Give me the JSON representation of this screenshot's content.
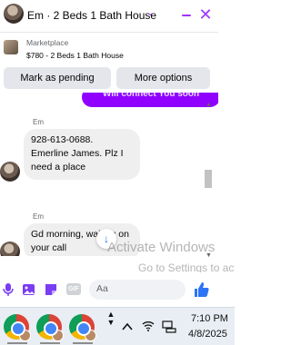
{
  "header": {
    "title": "Em · 2 Beds 1 Bath House",
    "chevron_glyph": "⌄",
    "close_glyph": "✕"
  },
  "marketplace": {
    "label": "Marketplace",
    "listing": "$780 - 2 Beds 1 Bath House",
    "mark_pending_label": "Mark as pending",
    "more_options_label": "More options"
  },
  "messages": {
    "previous_bubble_text": "Will connect You soon",
    "items": [
      {
        "sender": "Em",
        "text": "928-613-0688. Emerline James. Plz I need a place"
      },
      {
        "sender": "Em",
        "text": "Gd morning, waiting on your call"
      }
    ]
  },
  "overlay": {
    "line1": "Activate Windows",
    "line2": "Go to Settings to activate Windows."
  },
  "composer": {
    "placeholder": "Aa",
    "gif_label": "GIF"
  },
  "taskbar": {
    "time": "7:10 PM",
    "date": "4/8/2025"
  },
  "colors": {
    "accent": "#a033ff",
    "bubble_purple": "#8f00ff",
    "like_blue": "#2d73f5"
  },
  "icons": [
    "chevron-down-icon",
    "minimize-icon",
    "close-icon",
    "mic-icon",
    "photo-icon",
    "sticker-icon",
    "gif-icon",
    "emoji-icon",
    "like-icon",
    "arrow-down-icon",
    "chrome-icon",
    "wifi-icon",
    "volume-icon",
    "network-icon"
  ]
}
